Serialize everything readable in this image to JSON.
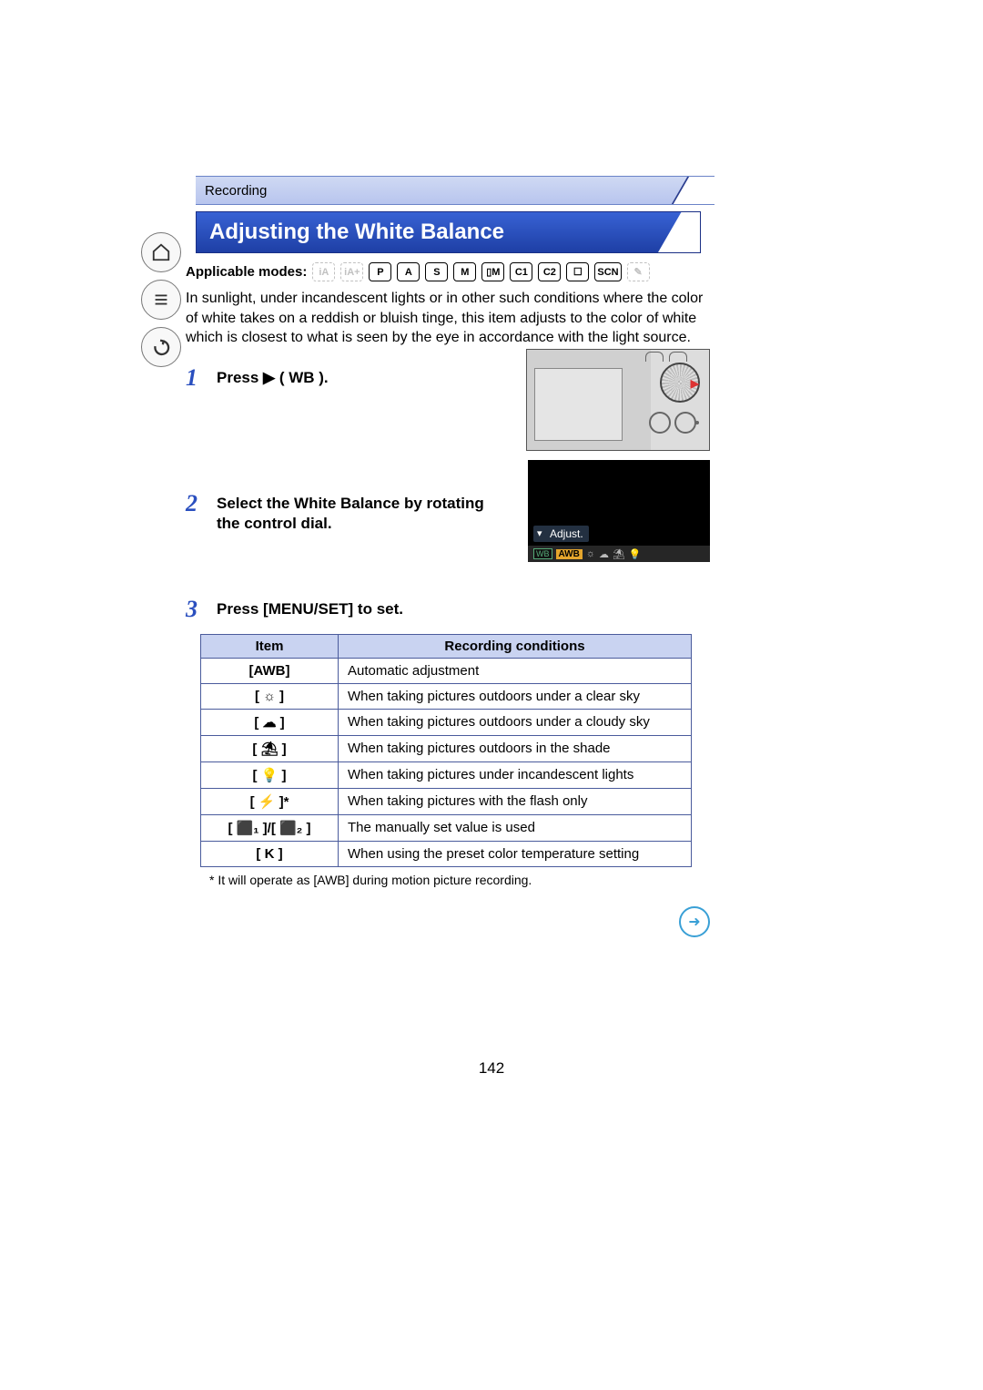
{
  "breadcrumb": "Recording",
  "title": "Adjusting the White Balance",
  "applicable_label": "Applicable modes:",
  "intro": "In sunlight, under incandescent lights or in other such conditions where the color of white takes on a reddish or bluish tinge, this item adjusts to the color of white which is closest to what is seen by the eye in accordance with the light source.",
  "steps": {
    "s1_num": "1",
    "s1_text": "Press ▶ ( WB ).",
    "s2_num": "2",
    "s2_text": "Select the White Balance by rotating the control dial.",
    "s3_num": "3",
    "s3_text": "Press [MENU/SET] to set."
  },
  "screen": {
    "adjust_label": "Adjust.",
    "wb_tag": "WB",
    "awb_sel": "AWB"
  },
  "table": {
    "head_item": "Item",
    "head_cond": "Recording conditions",
    "rows": [
      {
        "item": "[AWB]",
        "desc": "Automatic adjustment"
      },
      {
        "item": "[ ☼ ]",
        "desc": "When taking pictures outdoors under a clear sky"
      },
      {
        "item": "[ ☁ ]",
        "desc": "When taking pictures outdoors under a cloudy sky"
      },
      {
        "item": "[ ⛱ ]",
        "desc": "When taking pictures outdoors in the shade"
      },
      {
        "item": "[ 💡 ]",
        "desc": "When taking pictures under incandescent lights"
      },
      {
        "item": "[ ⚡ ]*",
        "desc": "When taking pictures with the flash only"
      },
      {
        "item": "[ ⬛₁ ]/[ ⬛₂ ]",
        "desc": "The manually set value is used"
      },
      {
        "item": "[ K ]",
        "desc": "When using the preset color temperature setting"
      }
    ]
  },
  "footnote": "* It will operate as [AWB] during motion picture recording.",
  "page_number": "142",
  "modes": [
    "iA",
    "iA+",
    "P",
    "A",
    "S",
    "M",
    "▯M",
    "C1",
    "C2",
    "☐",
    "SCN",
    "✎"
  ]
}
